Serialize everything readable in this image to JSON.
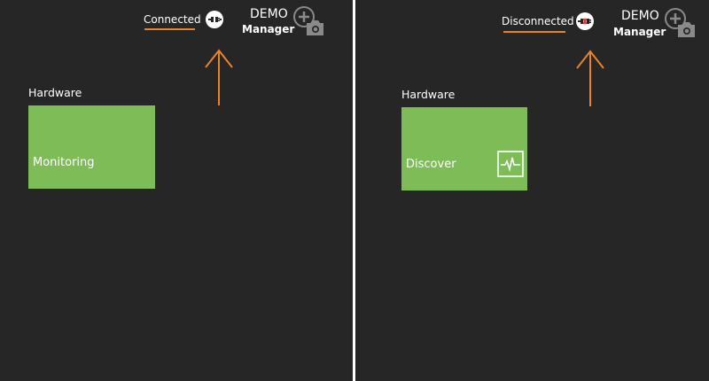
{
  "panels": [
    {
      "status": {
        "label": "Connected",
        "state": "connected"
      },
      "app": {
        "name": "DEMO",
        "sub": "Manager"
      },
      "group": {
        "title": "Hardware"
      },
      "tile": {
        "label": "Monitoring",
        "icon": "none"
      }
    },
    {
      "status": {
        "label": "Disconnected",
        "state": "disconnected"
      },
      "app": {
        "name": "DEMO",
        "sub": "Manager"
      },
      "group": {
        "title": "Hardware"
      },
      "tile": {
        "label": "Discover",
        "icon": "pulse-icon"
      }
    }
  ],
  "icons": {
    "connection": "plug-icon",
    "avatar": "add-photo-icon",
    "arrow": "arrow-up-icon"
  },
  "colors": {
    "background": "#262626",
    "tile": "#7dbc57",
    "accent": "#e8832a",
    "disconnected_mark": "#e0302a",
    "avatar": "#8a8a8a",
    "text": "#ffffff"
  }
}
